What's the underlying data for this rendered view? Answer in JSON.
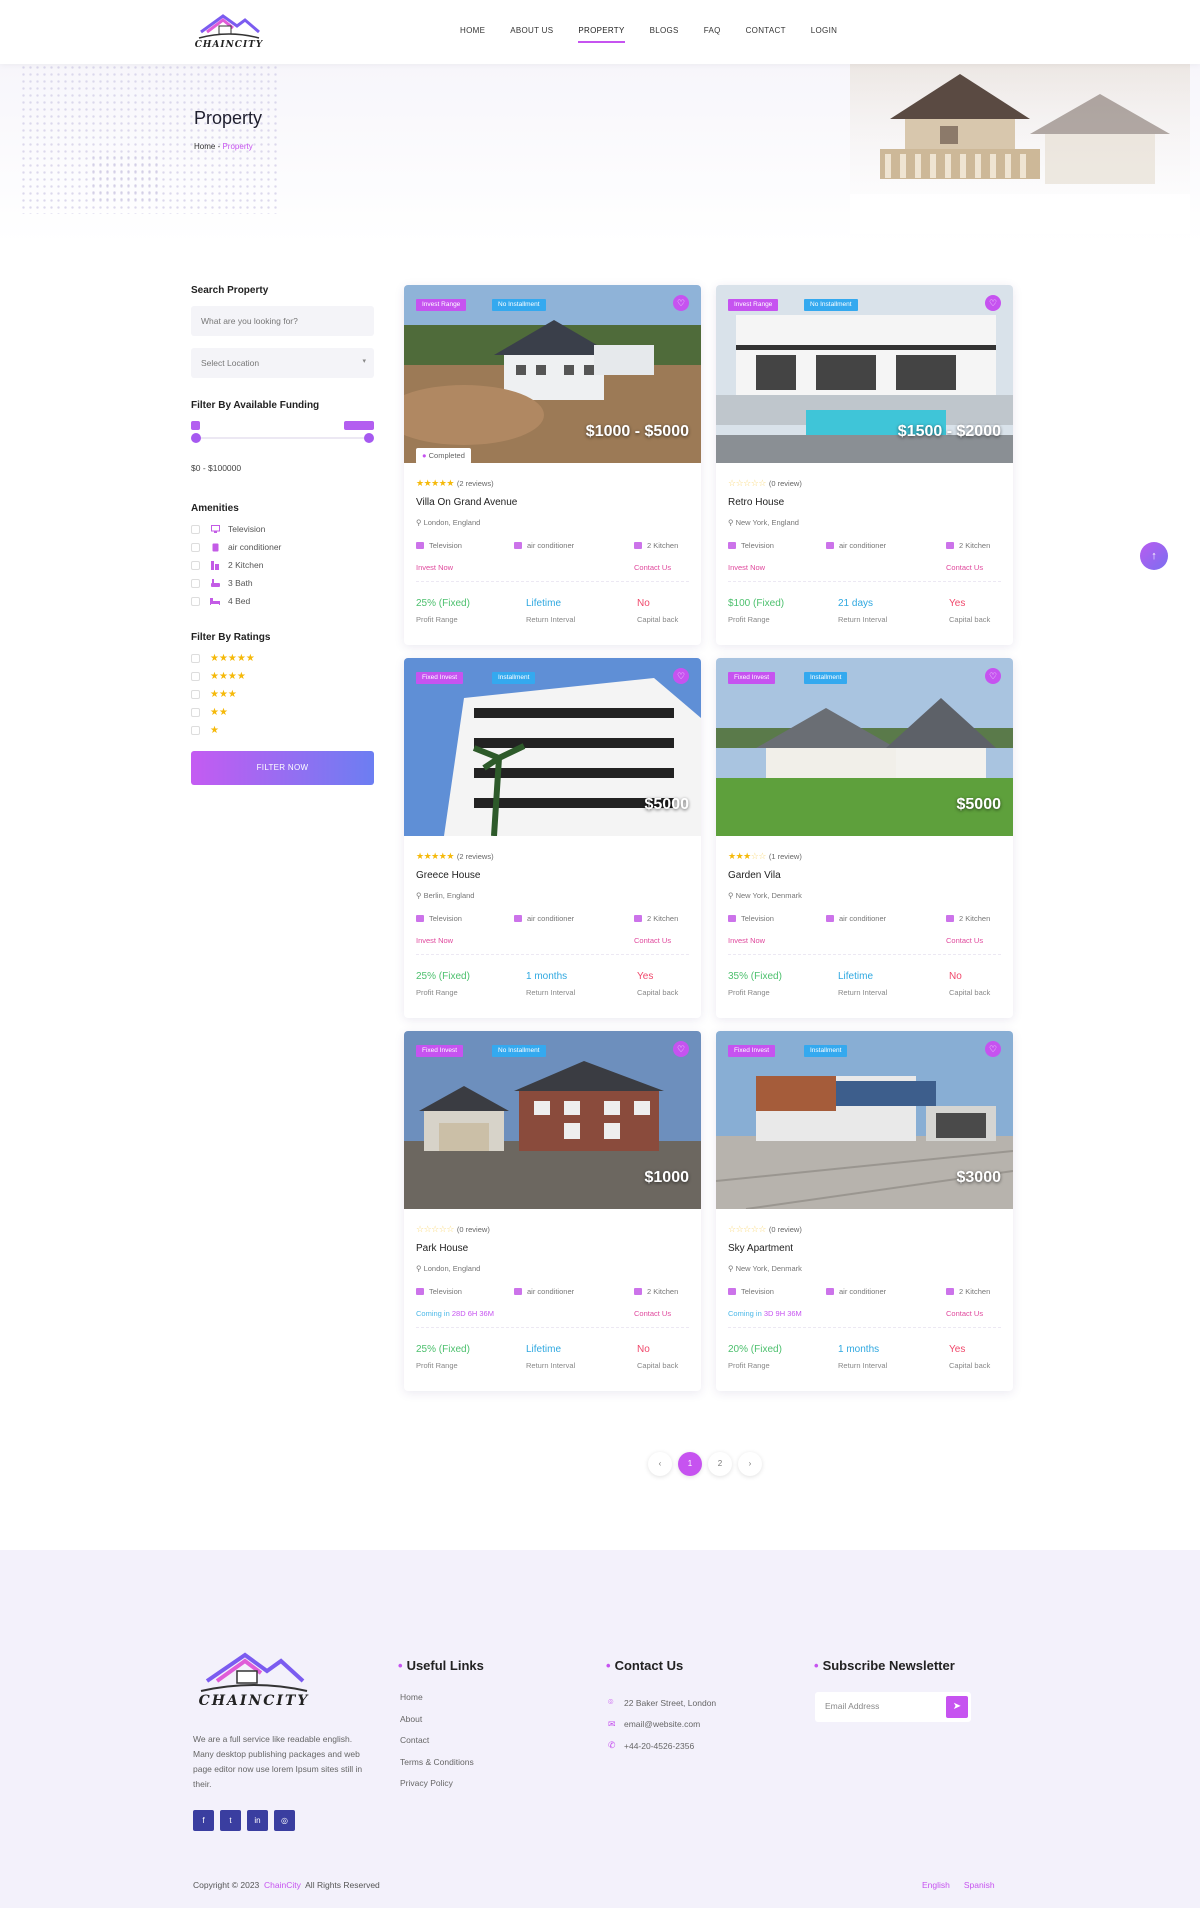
{
  "nav": [
    "HOME",
    "ABOUT US",
    "PROPERTY",
    "BLOGS",
    "FAQ",
    "CONTACT",
    "LOGIN"
  ],
  "logo_text": "CHAINCITY",
  "hero": {
    "title": "Property",
    "crumb_home": "Home",
    "crumb_current": "Property"
  },
  "sidebar": {
    "search_title": "Search Property",
    "search_placeholder": "What are you looking for?",
    "location_placeholder": "Select Location",
    "funding_title": "Filter By Available Funding",
    "range_text": "$0 - $100000",
    "amenities_title": "Amenities",
    "amenities": [
      "Television",
      "air conditioner",
      "2 Kitchen",
      "3 Bath",
      "4 Bed"
    ],
    "ratings_title": "Filter By Ratings",
    "filter_button": "FILTER NOW"
  },
  "cards": [
    {
      "tag1": "Invest Range",
      "tag2": "No Installment",
      "price": "$1000 - $5000",
      "completed": "Completed",
      "stars": 4.5,
      "reviews": "(2 reviews)",
      "name": "Villa On Grand Avenue",
      "location": "London, England",
      "features": [
        "Television",
        "air conditioner",
        "2 Kitchen"
      ],
      "action": "Invest Now",
      "contact": "Contact Us",
      "profit": "25% (Fixed)",
      "return": "Lifetime",
      "capital": "No",
      "profit_label": "Profit Range",
      "return_label": "Return Interval",
      "capital_label": "Capital back"
    },
    {
      "tag1": "Invest Range",
      "tag2": "No Installment",
      "price": "$1500 - $2000",
      "stars": 0,
      "reviews": "(0 review)",
      "name": "Retro House",
      "location": "New York, England",
      "features": [
        "Television",
        "air conditioner",
        "2 Kitchen"
      ],
      "action": "Invest Now",
      "contact": "Contact Us",
      "profit": "$100 (Fixed)",
      "return": "21 days",
      "capital": "Yes",
      "profit_label": "Profit Range",
      "return_label": "Return Interval",
      "capital_label": "Capital back"
    },
    {
      "tag1": "Fixed Invest",
      "tag2": "Installment",
      "price": "$5000",
      "stars": 5,
      "reviews": "(2 reviews)",
      "name": "Greece House",
      "location": "Berlin, England",
      "features": [
        "Television",
        "air conditioner",
        "2 Kitchen"
      ],
      "action": "Invest Now",
      "contact": "Contact Us",
      "profit": "25% (Fixed)",
      "return": "1 months",
      "capital": "Yes",
      "profit_label": "Profit Range",
      "return_label": "Return Interval",
      "capital_label": "Capital back"
    },
    {
      "tag1": "Fixed Invest",
      "tag2": "Installment",
      "price": "$5000",
      "stars": 3,
      "reviews": "(1 review)",
      "name": "Garden Vila",
      "location": "New York, Denmark",
      "features": [
        "Television",
        "air conditioner",
        "2 Kitchen"
      ],
      "action": "Invest Now",
      "contact": "Contact Us",
      "profit": "35% (Fixed)",
      "return": "Lifetime",
      "capital": "No",
      "profit_label": "Profit Range",
      "return_label": "Return Interval",
      "capital_label": "Capital back"
    },
    {
      "tag1": "Fixed Invest",
      "tag2": "No Installment",
      "price": "$1000",
      "stars": 0,
      "reviews": "(0 review)",
      "name": "Park House",
      "location": "London, England",
      "features": [
        "Television",
        "air conditioner",
        "2 Kitchen"
      ],
      "coming": "Coming in",
      "coming_time": "28D 6H 36M",
      "contact": "Contact Us",
      "profit": "25% (Fixed)",
      "return": "Lifetime",
      "capital": "No",
      "profit_label": "Profit Range",
      "return_label": "Return Interval",
      "capital_label": "Capital back"
    },
    {
      "tag1": "Fixed Invest",
      "tag2": "Installment",
      "price": "$3000",
      "stars": 0,
      "reviews": "(0 review)",
      "name": "Sky Apartment",
      "location": "New York, Denmark",
      "features": [
        "Television",
        "air conditioner",
        "2 Kitchen"
      ],
      "coming": "Coming in",
      "coming_time": "3D 9H 36M",
      "contact": "Contact Us",
      "profit": "20% (Fixed)",
      "return": "1 months",
      "capital": "Yes",
      "profit_label": "Profit Range",
      "return_label": "Return Interval",
      "capital_label": "Capital back"
    }
  ],
  "pagination": [
    "‹",
    "1",
    "2",
    "›"
  ],
  "footer": {
    "logo_text": "CHAINCITY",
    "about": "We are a full service like readable english. Many desktop publishing packages and web page editor now use lorem Ipsum sites still in their.",
    "socials": [
      "f",
      "t",
      "in",
      "◎"
    ],
    "useful_title": "Useful Links",
    "useful": [
      "Home",
      "About",
      "Contact",
      "Terms & Conditions",
      "Privacy Policy"
    ],
    "contact_title": "Contact Us",
    "contact": [
      "22 Baker Street, London",
      "email@website.com",
      "+44-20-4526-2356"
    ],
    "newsletter_title": "Subscribe Newsletter",
    "email_placeholder": "Email Address",
    "copyright_pre": "Copyright © 2023",
    "copyright_brand": "ChainCity",
    "copyright_post": "All Rights Reserved",
    "langs": [
      "English",
      "Spanish"
    ]
  },
  "colors": {
    "accent": "#c653f0",
    "blue": "#34a9ef",
    "green": "#4dc06e",
    "red": "#f0486b"
  }
}
